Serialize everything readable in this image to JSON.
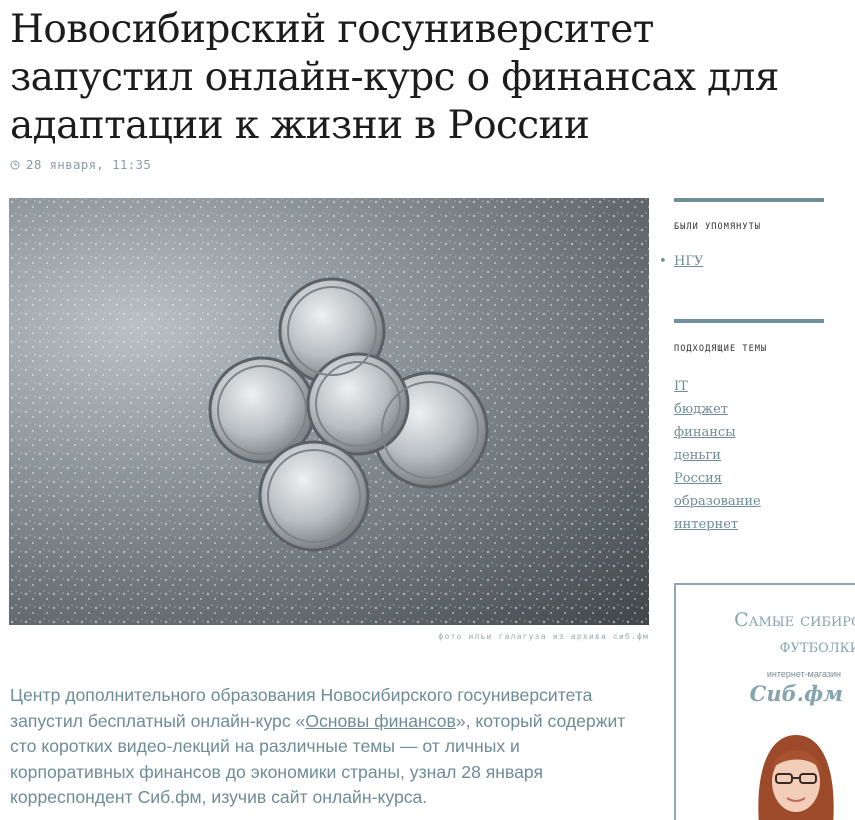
{
  "article": {
    "title": "Новосибирский госуниверситет запустил онлайн-курс о финансах для адаптации к жизни в России",
    "date": "28 января, 11:35",
    "photo_caption": "фото ильи галагуза из архива сиб.фм",
    "body_before_link": "Центр дополнительного образования Новосибирского госуниверситета запустил бесплатный онлайн-курс «",
    "body_link": "Основы финансов",
    "body_after_link": "», который содержит сто коротких видео-лекций на различные темы — от личных и корпоративных финансов до экономики страны, узнал 28 января корреспондент Сиб.фм, изучив сайт онлайн-курса."
  },
  "sidebar": {
    "mentioned_heading": "были упомянуты",
    "mentioned": [
      "НГУ"
    ],
    "topics_heading": "подходящие темы",
    "topics": [
      "IT",
      "бюджет",
      "финансы",
      "деньги",
      "Россия",
      "образование",
      "интернет"
    ]
  },
  "ad": {
    "title_line1": "Самые сибирс",
    "title_line2": "футболки",
    "subtitle": "интернет-магазин",
    "brand": "Сиб.фм"
  },
  "icons": {
    "date": "clock-icon"
  },
  "colors": {
    "accent": "#6d8c95",
    "rule": "#6f8f99"
  }
}
